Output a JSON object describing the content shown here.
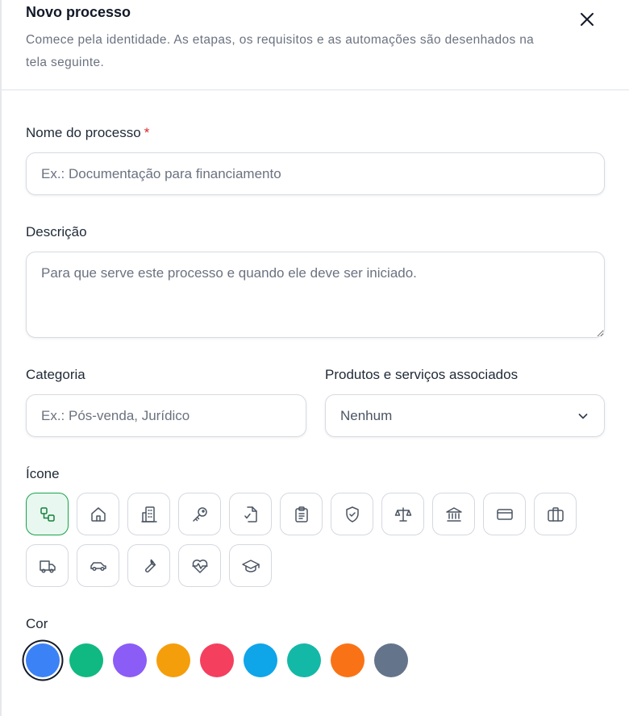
{
  "header": {
    "title": "Novo processo",
    "subtitle": "Comece pela identidade. As etapas, os requisitos e as automações são desenhados na tela seguinte."
  },
  "form": {
    "name": {
      "label": "Nome do processo",
      "required_mark": "*",
      "placeholder": "Ex.: Documentação para financiamento",
      "value": ""
    },
    "description": {
      "label": "Descrição",
      "placeholder": "Para que serve este processo e quando ele deve ser iniciado.",
      "value": ""
    },
    "category": {
      "label": "Categoria",
      "placeholder": "Ex.: Pós-venda, Jurídico",
      "value": ""
    },
    "products": {
      "label": "Produtos e serviços associados",
      "selected": "Nenhum"
    },
    "icon": {
      "label": "Ícone",
      "selected": "flow-icon",
      "options": [
        "flow-icon",
        "house-icon",
        "building-icon",
        "key-icon",
        "document-check-icon",
        "clipboard-icon",
        "shield-check-icon",
        "scale-icon",
        "bank-icon",
        "credit-card-icon",
        "briefcase-icon",
        "truck-icon",
        "car-icon",
        "wrench-icon",
        "heart-pulse-icon",
        "graduation-cap-icon"
      ]
    },
    "color": {
      "label": "Cor",
      "selected": "#3b82f6",
      "options": [
        "#3b82f6",
        "#10b981",
        "#8b5cf6",
        "#f59e0b",
        "#f43f5e",
        "#0ea5e9",
        "#14b8a6",
        "#f97316",
        "#64748b"
      ]
    }
  },
  "colors": {
    "accent": "#16a34a",
    "required": "#dc2626"
  }
}
